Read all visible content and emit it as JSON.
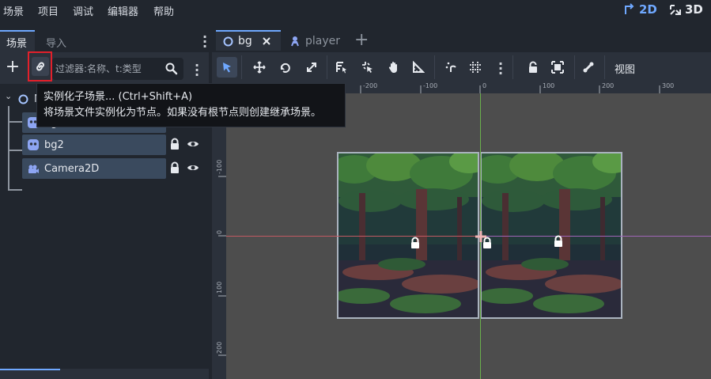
{
  "menu": {
    "items": [
      "场景",
      "项目",
      "调试",
      "编辑器",
      "帮助"
    ],
    "mode_2d": "2D",
    "mode_3d": "3D"
  },
  "scene_dock": {
    "tabs": [
      "场景",
      "导入"
    ],
    "filter_placeholder": "过滤器:名称、t:类型",
    "root_label": "N",
    "nodes": [
      {
        "label": "bg",
        "icon": "sprite-icon"
      },
      {
        "label": "bg2",
        "icon": "sprite-icon"
      },
      {
        "label": "Camera2D",
        "icon": "camera-icon"
      }
    ]
  },
  "tooltip": {
    "title": "实例化子场景... (Ctrl+Shift+A)",
    "description": "将场景文件实例化为节点。如果没有根节点则创建继承场景。"
  },
  "editor_tabs": {
    "tabs": [
      {
        "label": "bg",
        "active": true
      },
      {
        "label": "player",
        "active": false
      }
    ]
  },
  "toolbar": {
    "view_label": "视图"
  },
  "viewport": {
    "ruler_x_labels": [
      "-200",
      "-100",
      "0",
      "100",
      "200",
      "300"
    ],
    "ruler_y_labels": [
      "-100",
      "0",
      "100",
      "200"
    ]
  },
  "colors": {
    "accent": "#6fa8ff",
    "highlight_border": "#e2202b",
    "x_axis": "#c25a63",
    "y_axis": "#6ab04b"
  }
}
